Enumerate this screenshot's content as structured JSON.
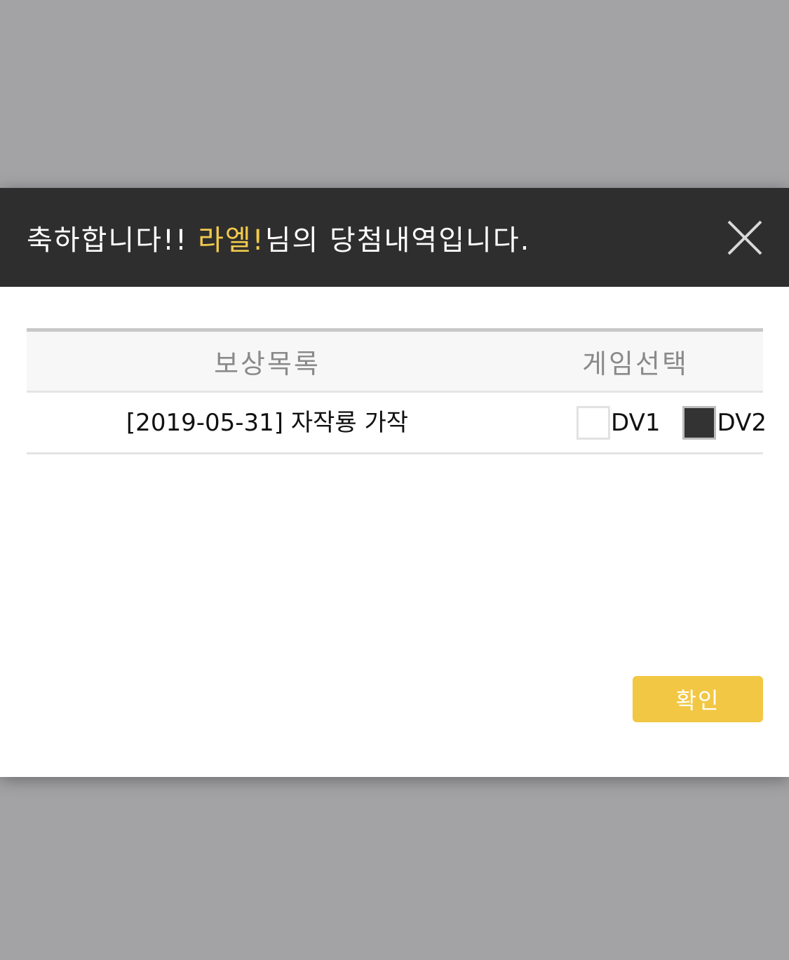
{
  "dialog": {
    "title_prefix": "축하합니다!!",
    "user_name": "라엘!",
    "title_suffix": "님의 당첨내역입니다.",
    "colors": {
      "header_bg": "#2e2e2e",
      "highlight": "#f2c94c",
      "button_bg": "#f2c744"
    }
  },
  "table": {
    "headers": [
      "보상목록",
      "게임선택"
    ],
    "rows": [
      {
        "reward": "[2019-05-31] 자작룡 가작",
        "options": [
          {
            "label": "DV1",
            "checked": false
          },
          {
            "label": "DV2",
            "checked": true
          }
        ]
      }
    ]
  },
  "buttons": {
    "confirm_label": "확인",
    "close_icon": "close-icon"
  }
}
